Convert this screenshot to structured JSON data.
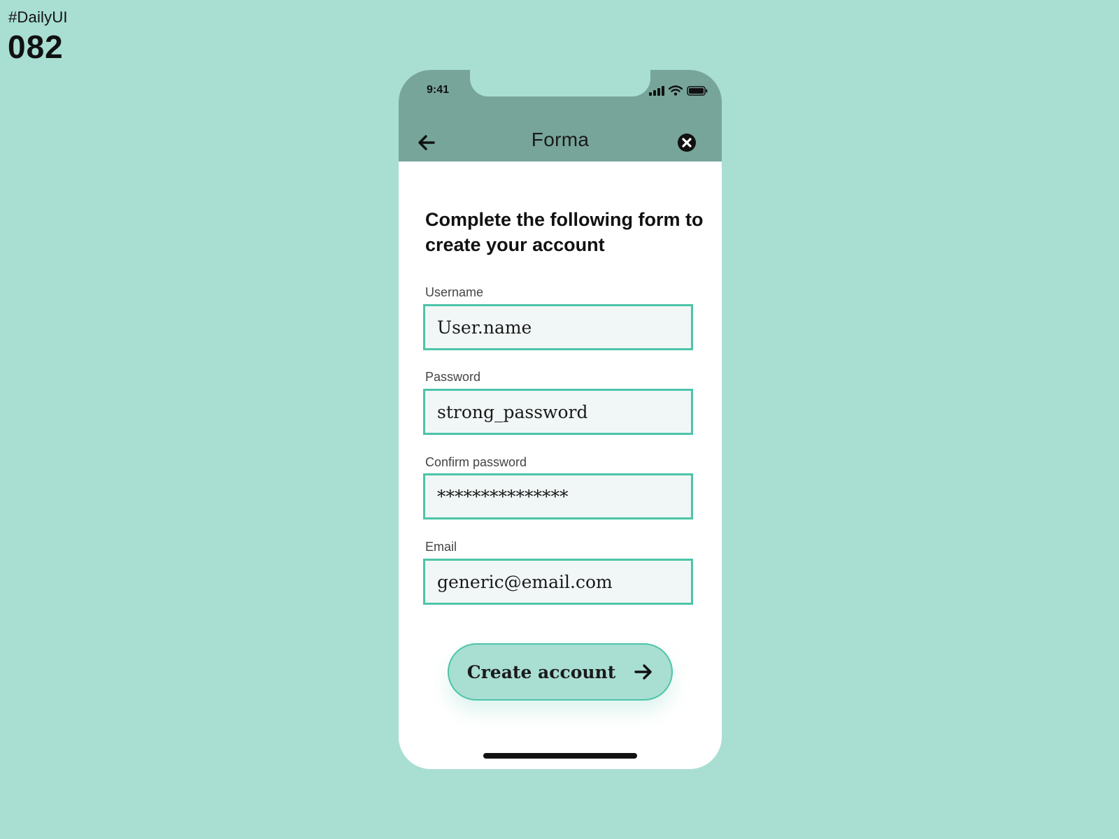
{
  "page": {
    "tag": "#DailyUI",
    "number": "082",
    "background_color": "#a9ded3"
  },
  "status_bar": {
    "time": "9:41",
    "icons": [
      "cellular-signal-icon",
      "wifi-icon",
      "battery-icon"
    ]
  },
  "header": {
    "title": "Forma",
    "back_icon": "arrow-left-icon",
    "close_icon": "close-circle-icon",
    "color": "#77a59a"
  },
  "form": {
    "title": "Complete the following form to create your account",
    "accent_color": "#4dc4a9",
    "fields": {
      "username": {
        "label": "Username",
        "value": "User.name"
      },
      "password": {
        "label": "Password",
        "value": "strong_password"
      },
      "confirm_password": {
        "label": "Confirm password",
        "value": "***************"
      },
      "email": {
        "label": "Email",
        "value": "generic@email.com"
      }
    },
    "submit": {
      "label": "Create account",
      "icon": "arrow-right-icon"
    }
  }
}
